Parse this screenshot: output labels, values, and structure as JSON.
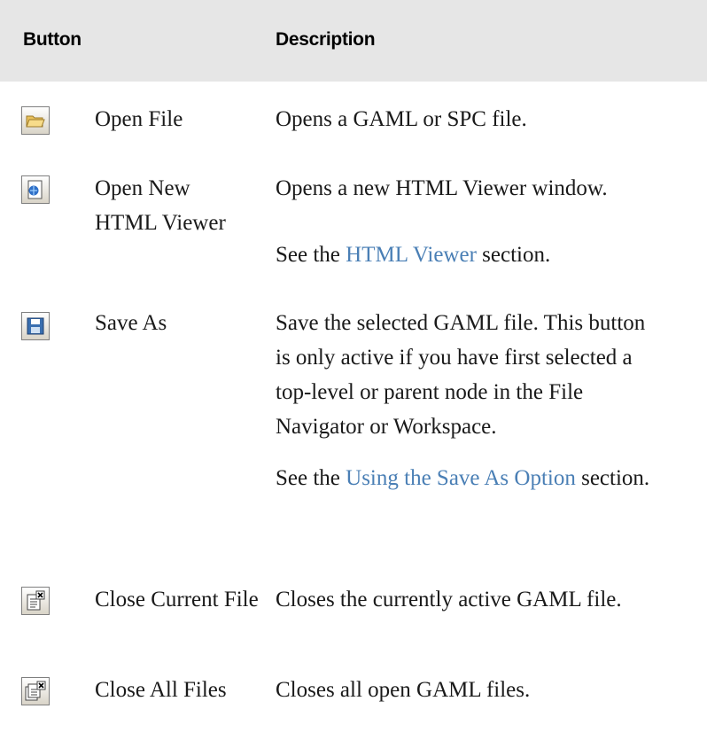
{
  "table": {
    "headers": {
      "button": "Button",
      "description": "Description"
    },
    "rows": [
      {
        "icon": "open-folder-icon",
        "label": "Open File",
        "description": "Opens a GAML or SPC file."
      },
      {
        "icon": "html-viewer-icon",
        "label": "Open New HTML Viewer",
        "description": "Opens a new HTML Viewer window.",
        "see_prefix": "See the",
        "see_link": "HTML Viewer",
        "see_suffix": "section."
      },
      {
        "icon": "save-disk-icon",
        "label": "Save As",
        "description": "Save the selected GAML file. This button is only active if you have first selected a top-level or parent node in the File Navigator or Workspace.",
        "see_prefix": "See the",
        "see_link": "Using the Save As Option",
        "see_suffix": "section."
      },
      {
        "icon": "close-file-icon",
        "label": "Close Current File",
        "description": "Closes the currently active GAML file."
      },
      {
        "icon": "close-all-files-icon",
        "label": "Close All Files",
        "description": "Closes all open GAML files."
      }
    ]
  },
  "colors": {
    "header_bg": "#e6e6e6",
    "link": "#4a7fb5",
    "text": "#1a1a1a"
  }
}
